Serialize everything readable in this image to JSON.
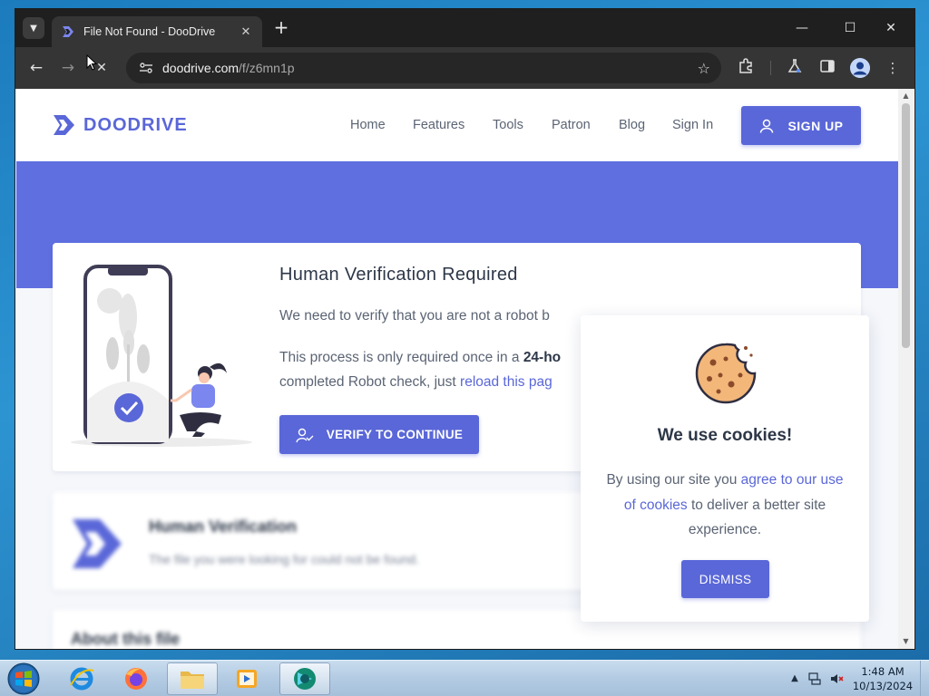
{
  "browser": {
    "tab_title": "File Not Found - DooDrive",
    "url_host": "doodrive.com",
    "url_path": "/f/z6mn1p",
    "new_tab_symbol": "+",
    "tab_close_symbol": "✕"
  },
  "site": {
    "logo_text": "DOODRIVE",
    "nav": [
      "Home",
      "Features",
      "Tools",
      "Patron",
      "Blog",
      "Sign In"
    ],
    "signup_label": "SIGN UP",
    "accent_color": "#5a67d8"
  },
  "verification": {
    "title": "Human Verification Required",
    "line1": "We need to verify that you are not a robot b",
    "line2_pre": "This process is only required once in a ",
    "line2_bold": "24-ho",
    "line3_pre": "completed Robot check, just ",
    "line3_link": "reload this pag",
    "button_label": "VERIFY TO CONTINUE"
  },
  "blurred": {
    "hv_title": "Human Verification",
    "hv_sub": "The file you were looking for could not be found.",
    "about_title": "About this file"
  },
  "cookie": {
    "title": "We use cookies!",
    "text_pre": "By using our site you ",
    "text_link": "agree to our use of cookies",
    "text_post": " to deliver a better site experience.",
    "dismiss_label": "DISMISS"
  },
  "taskbar": {
    "time": "1:48 AM",
    "date": "10/13/2024",
    "apps": [
      "internet-explorer",
      "firefox",
      "file-explorer",
      "media-player",
      "browser-active"
    ]
  }
}
